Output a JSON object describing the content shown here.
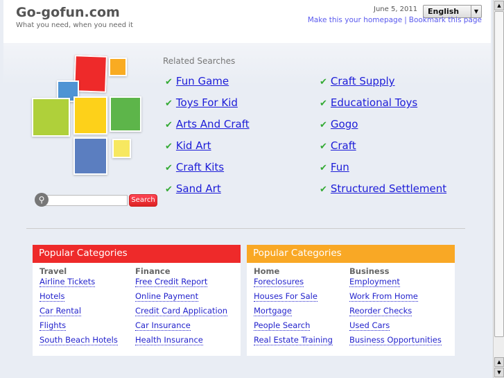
{
  "header": {
    "title": "Go-gofun.com",
    "tagline": "What you need, when you need it",
    "date": "June 5, 2011",
    "language": "English",
    "homepage_link": "Make this your homepage",
    "separator": "|",
    "bookmark_link": "Bookmark this page"
  },
  "search": {
    "button": "Search",
    "value": ""
  },
  "related": {
    "title": "Related Searches",
    "items": [
      "Fun Game",
      "Toys For Kid",
      "Arts And Craft",
      "Kid Art",
      "Craft Kits",
      "Sand Art",
      "Craft Supply",
      "Educational Toys",
      "Gogo",
      "Craft",
      "Fun",
      "Structured Settlement"
    ]
  },
  "boxes": [
    {
      "title": "Popular Categories",
      "color": "#ee2a2a",
      "cols": [
        {
          "heading": "Travel",
          "links": [
            "Airline Tickets",
            "Hotels",
            "Car Rental",
            "Flights",
            "South Beach Hotels"
          ]
        },
        {
          "heading": "Finance",
          "links": [
            "Free Credit Report",
            "Online Payment",
            "Credit Card Application",
            "Car Insurance",
            "Health Insurance"
          ]
        }
      ]
    },
    {
      "title": "Popular Categories",
      "color": "#f9a825",
      "cols": [
        {
          "heading": "Home",
          "links": [
            "Foreclosures",
            "Houses For Sale",
            "Mortgage",
            "People Search",
            "Real Estate Training"
          ]
        },
        {
          "heading": "Business",
          "links": [
            "Employment",
            "Work From Home",
            "Reorder Checks",
            "Used Cars",
            "Business Opportunities"
          ]
        }
      ]
    }
  ]
}
